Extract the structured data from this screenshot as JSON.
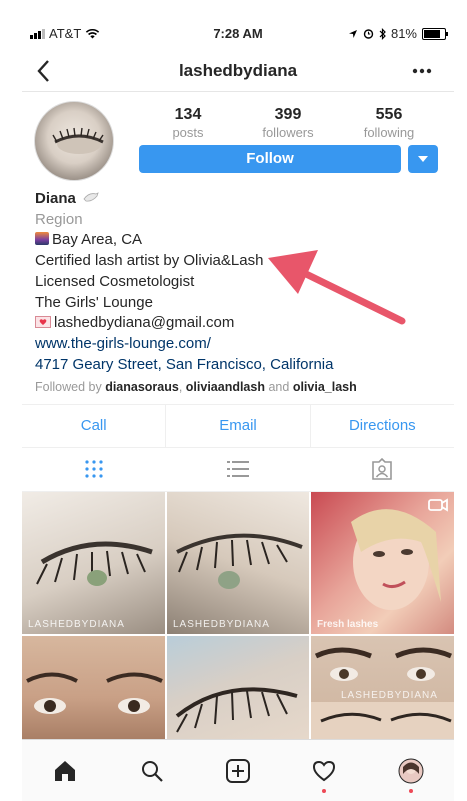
{
  "status_bar": {
    "carrier": "AT&T",
    "time": "7:28 AM",
    "battery": "81%",
    "battery_level": 0.81
  },
  "nav": {
    "title": "lashedbydiana"
  },
  "stats": [
    {
      "value": "134",
      "label": "posts"
    },
    {
      "value": "399",
      "label": "followers"
    },
    {
      "value": "556",
      "label": "following"
    }
  ],
  "follow_button": {
    "label": "Follow"
  },
  "bio": {
    "name": "Diana",
    "category": "Region",
    "location": "Bay Area, CA",
    "line_certified": "Certified lash artist by Olivia&Lash",
    "line_license": "Licensed Cosmetologist",
    "line_shop": "The Girls' Lounge",
    "email": "lashedbydiana@gmail.com",
    "website": "www.the-girls-lounge.com/",
    "address": "4717 Geary Street, San Francisco, California",
    "followed_by_prefix": "Followed by",
    "followed_by_1": "dianasoraus",
    "followed_by_2": "oliviaandlash",
    "followed_by_and": "and",
    "followed_by_3": "olivia_lash"
  },
  "action_buttons": {
    "call": "Call",
    "email": "Email",
    "directions": "Directions"
  },
  "grid": {
    "watermark_1": "LASHEDBYDIANA",
    "watermark_2": "LASHEDBYDIANA",
    "caption_3": "Fresh lashes",
    "watermark_6": "LASHEDBYDIANA"
  },
  "colors": {
    "accent": "#3897f0",
    "link": "#003569",
    "arrow": "#e8566a",
    "notification": "#ed4956"
  }
}
